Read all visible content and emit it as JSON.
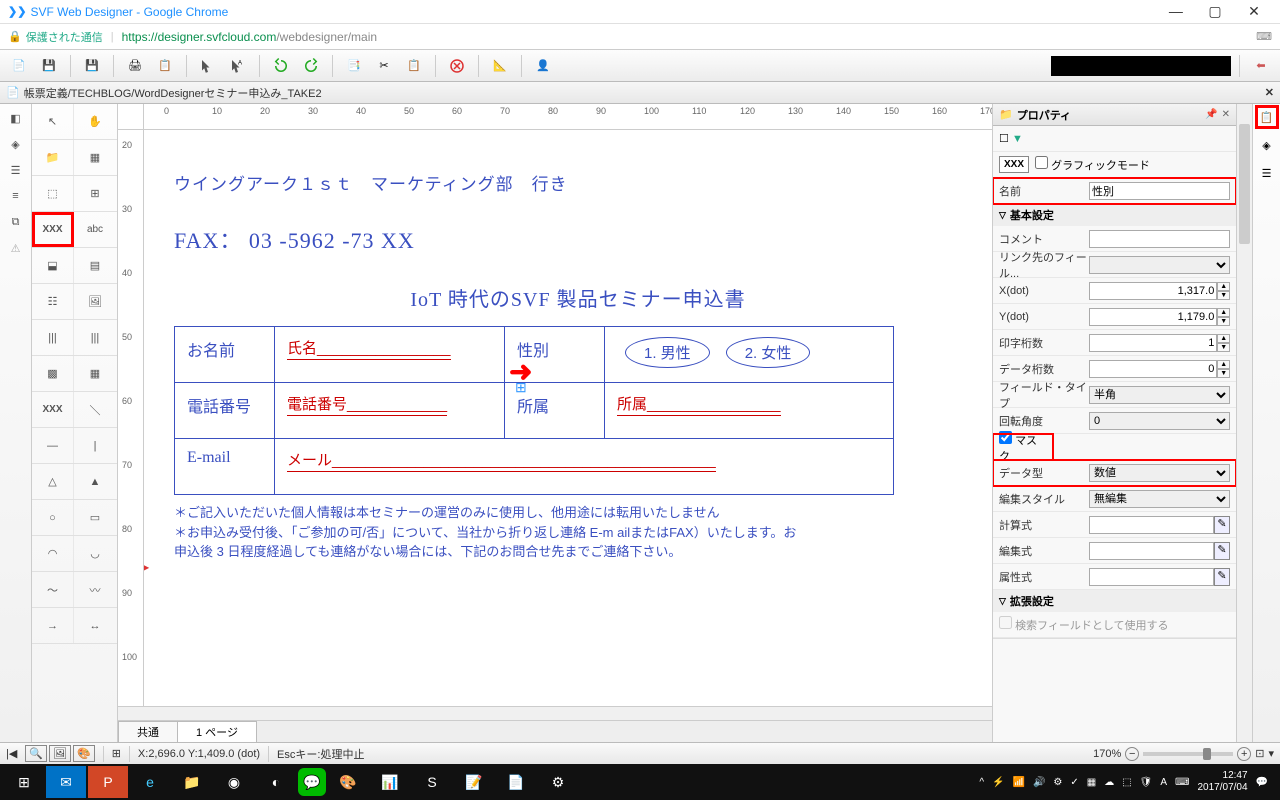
{
  "window": {
    "title": "SVF Web Designer - Google Chrome"
  },
  "address": {
    "secure": "保護された通信",
    "domain": "https://designer.svfcloud.com",
    "path": "/webdesigner/main"
  },
  "tab": {
    "prefix": "帳票定義",
    "path": "/TECHBLOG/WordDesignerセミナー申込み_TAKE2"
  },
  "ruler_h": [
    0,
    10,
    20,
    30,
    40,
    50,
    60,
    70,
    80,
    90,
    100,
    110,
    120,
    130,
    140,
    150,
    160,
    170
  ],
  "ruler_v": [
    20,
    30,
    40,
    50,
    60,
    70,
    80,
    90,
    100
  ],
  "doc": {
    "line1": "ウイングアーク１ｓｔ　マーケティング部　行き",
    "fax": "FAX：  03 -5962 -73 XX",
    "title": "IoT 時代のSVF  製品セミナー申込書",
    "name_lbl": "お名前",
    "name_fld": "氏名",
    "gender_lbl": "性別",
    "gender1": "1. 男性",
    "gender2": "2. 女性",
    "tel_lbl": "電話番号",
    "tel_fld": "電話番号",
    "org_lbl": "所属",
    "org_fld": "所属",
    "email_lbl": "E-mail",
    "email_fld": "メール",
    "note1": "＊ご記入いただいた個人情報は本セミナーの運営のみに使用し、他用途には転用いたしません",
    "note2": "＊お申込み受付後、「ご参加の可/否」について、当社から折り返し連絡  E-m ailまたはFAX）いたします。お",
    "note3": "申込後 3 日程度経過しても連絡がない場合には、下記のお問合せ先までご連絡下さい。"
  },
  "pagetabs": {
    "common": "共通",
    "page1": "1 ページ"
  },
  "prop": {
    "title": "プロパティ",
    "graphic_mode": "グラフィックモード",
    "name_lbl": "名前",
    "name_val": "性別",
    "sec_basic": "基本設定",
    "comment": "コメント",
    "link": "リンク先のフィール...",
    "x_lbl": "X(dot)",
    "x_val": "1,317.0",
    "y_lbl": "Y(dot)",
    "y_val": "1,179.0",
    "print_digits_lbl": "印字桁数",
    "print_digits_val": "1",
    "data_digits_lbl": "データ桁数",
    "data_digits_val": "0",
    "field_type_lbl": "フィールド・タイプ",
    "field_type_val": "半角",
    "rotation_lbl": "回転角度",
    "rotation_val": "0",
    "mask_lbl": "マスク",
    "dtype_lbl": "データ型",
    "dtype_val": "数値",
    "editstyle_lbl": "編集スタイル",
    "editstyle_val": "無編集",
    "calc_lbl": "計算式",
    "edit_lbl": "編集式",
    "attr_lbl": "属性式",
    "sec_ext": "拡張設定",
    "search_lbl": "検索フィールドとして使用する"
  },
  "status": {
    "coords": "X:2,696.0 Y:1,409.0  (dot)",
    "esc": "Escキー:処理中止",
    "zoom": "170%"
  },
  "taskbar": {
    "time": "12:47",
    "date": "2017/07/04"
  }
}
